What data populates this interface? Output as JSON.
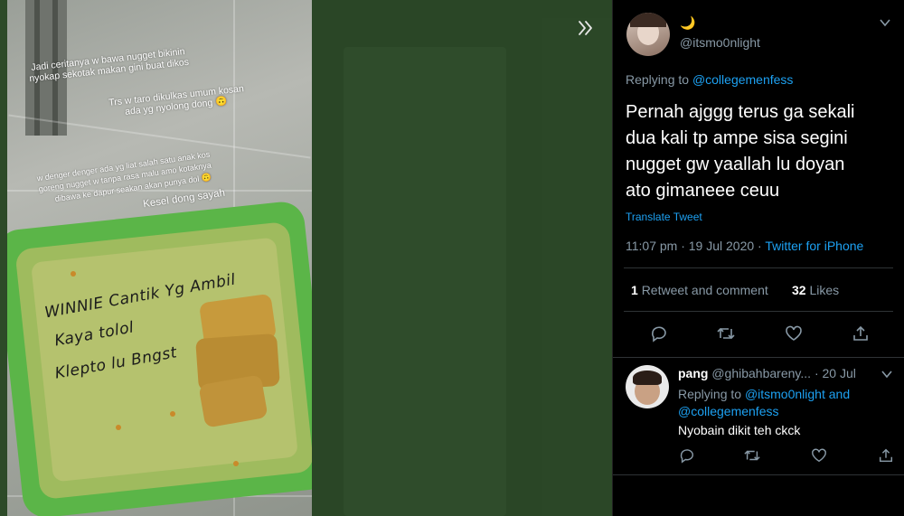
{
  "viewer": {
    "story_lines": [
      "Jadi ceritanya w bawa nugget bikinin",
      "nyokap sekotak makan gini buat dikos",
      "Trs w taro dikulkas umum kosan",
      "ada yg nyolong dong 🙃",
      "w denger denger ada yg liat salah satu anak kos",
      "goreng nugget w tanpa rasa malu amo kotaknya",
      "dibawa ke dapur seakan akan punya dol 🙃",
      "Kesel dong sayah"
    ],
    "container_note": [
      "WINNIE Cantik Yg Ambil",
      "Kaya tolol",
      "Klepto lu Bngst"
    ],
    "expand_icon": "double-chevron-right-icon"
  },
  "tweet": {
    "author": {
      "display_name": "🌙",
      "handle": "@itsmo0nlight"
    },
    "replying_prefix": "Replying to ",
    "replying_to": "@collegemenfess",
    "text_lines": [
      "Pernah ajggg terus ga sekali",
      "dua kali tp ampe sisa segini",
      "nugget gw yaallah lu doyan",
      "ato gimaneee ceuu"
    ],
    "translate": "Translate Tweet",
    "time": "11:07 pm · 19 Jul 2020 · ",
    "source": "Twitter for iPhone",
    "retweets_count": "1",
    "retweets_label": "Retweet and comment",
    "likes_count": "32",
    "likes_label": "Likes"
  },
  "reply": {
    "name": "pang",
    "handle": "@ghibahbareny...",
    "date": "· 20 Jul",
    "replying_prefix": "Replying to ",
    "replying_to_1": "@itsmo0nlight",
    "replying_and": " and",
    "replying_to_2": "@collegemenfess",
    "text": "Nyobain dikit teh ckck"
  },
  "colors": {
    "accent": "#1da1f2",
    "muted": "#8899a6",
    "background": "#000000",
    "overlay_green": "#2d4a28"
  }
}
